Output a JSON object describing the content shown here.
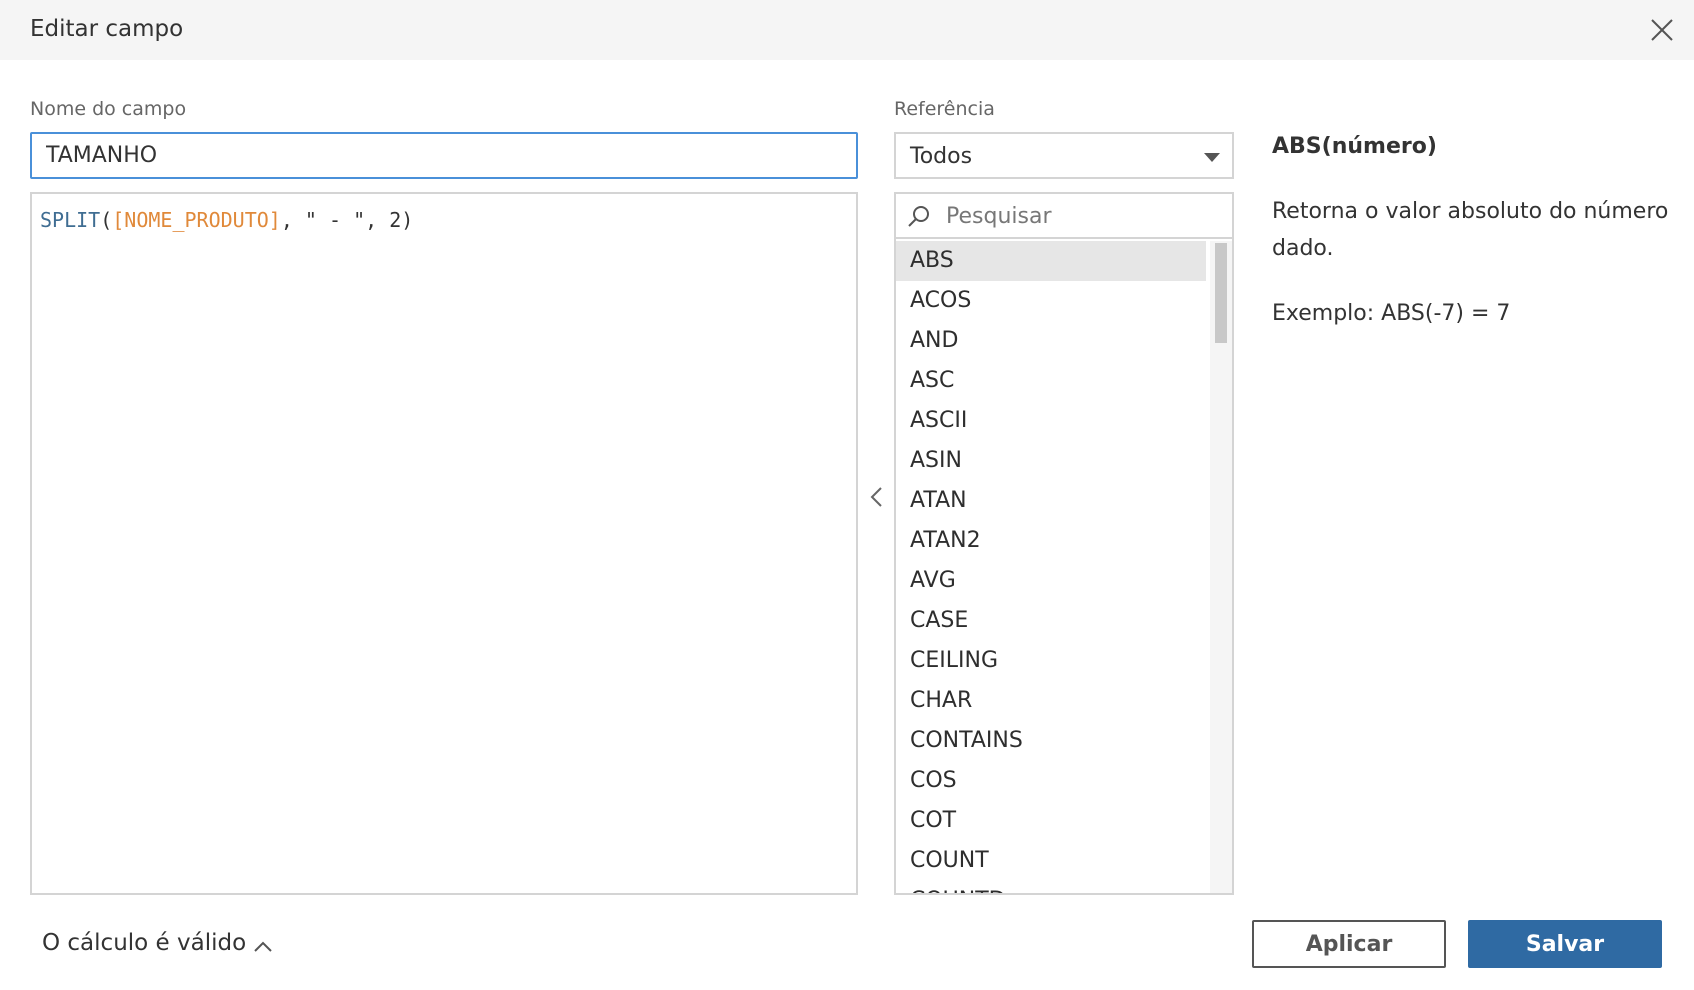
{
  "dialog": {
    "title": "Editar campo",
    "close_icon": "close-icon"
  },
  "field_name": {
    "label": "Nome do campo",
    "value": "TAMANHO"
  },
  "formula": {
    "function": "SPLIT",
    "open": "(",
    "field": "[NOME_PRODUTO]",
    "rest": ", \" - \", 2)"
  },
  "reference": {
    "label": "Referência",
    "selected": "Todos",
    "search_placeholder": "Pesquisar",
    "search_icon": "search-icon",
    "functions": [
      "ABS",
      "ACOS",
      "AND",
      "ASC",
      "ASCII",
      "ASIN",
      "ATAN",
      "ATAN2",
      "AVG",
      "CASE",
      "CEILING",
      "CHAR",
      "CONTAINS",
      "COS",
      "COT",
      "COUNT",
      "COUNTD"
    ],
    "selected_function": "ABS"
  },
  "doc": {
    "signature": "ABS(número)",
    "description": "Retorna o valor absoluto do número dado.",
    "example": "Exemplo: ABS(-7) = 7"
  },
  "footer": {
    "status": "O cálculo é válido",
    "apply_label": "Aplicar",
    "save_label": "Salvar"
  },
  "colors": {
    "accent_blue": "#2f6aa3",
    "focus_border": "#4a90d9",
    "function_color": "#3f6d92",
    "field_color": "#e0893a"
  }
}
